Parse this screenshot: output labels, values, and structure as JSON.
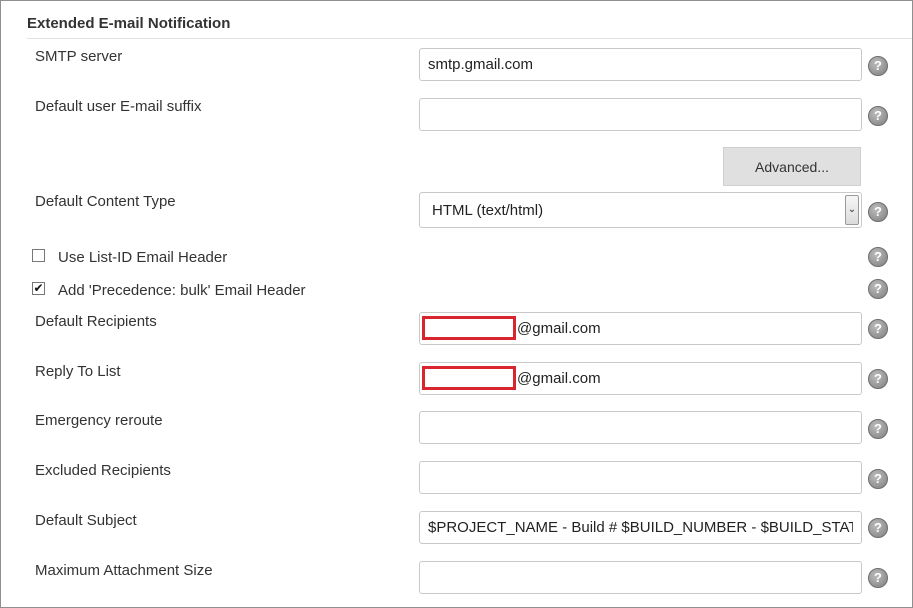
{
  "section": {
    "title": "Extended E-mail Notification"
  },
  "smtp": {
    "label": "SMTP server",
    "value": "smtp.gmail.com"
  },
  "suffix": {
    "label": "Default user E-mail suffix",
    "value": ""
  },
  "advanced": {
    "label": "Advanced..."
  },
  "content_type": {
    "label": "Default Content Type",
    "value": "HTML (text/html)"
  },
  "list_id": {
    "label": "Use List-ID Email Header",
    "checked": false
  },
  "precedence": {
    "label": "Add 'Precedence: bulk' Email Header",
    "checked": true
  },
  "recipients": {
    "label": "Default Recipients",
    "value_suffix": "@gmail.com"
  },
  "reply_to": {
    "label": "Reply To List",
    "value_suffix": "@gmail.com"
  },
  "emergency": {
    "label": "Emergency reroute",
    "value": ""
  },
  "excluded": {
    "label": "Excluded Recipients",
    "value": ""
  },
  "subject": {
    "label": "Default Subject",
    "value": "$PROJECT_NAME - Build # $BUILD_NUMBER - $BUILD_STATUS!"
  },
  "max_attach": {
    "label": "Maximum Attachment Size",
    "value": ""
  },
  "icons": {
    "help": "help-icon",
    "check": "checkmark-icon",
    "dropdown": "chevron-down-icon"
  },
  "glyphs": {
    "help": "?",
    "check": "✔",
    "dropdown": "⌄"
  },
  "colors": {
    "redaction": "#d9262e",
    "button_bg": "#e0e0e0",
    "help_icon": "#8a8a8a"
  }
}
